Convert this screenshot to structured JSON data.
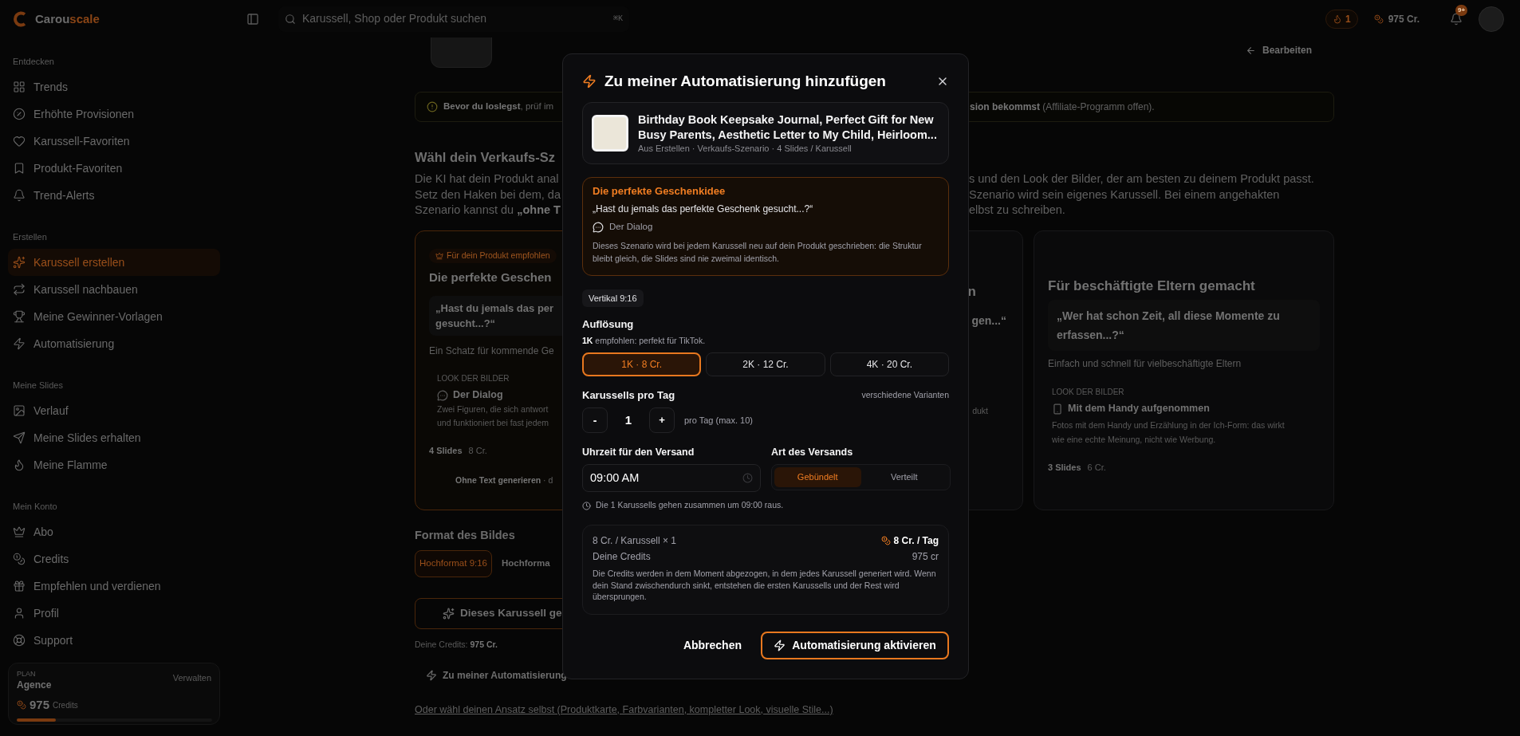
{
  "sidebar": {
    "brand": {
      "name": "Carou",
      "accent": "scale"
    },
    "sections": [
      {
        "title": "Entdecken",
        "items": [
          {
            "label": "Trends",
            "selected": false
          },
          {
            "label": "Erhöhte Provisionen",
            "selected": false
          },
          {
            "label": "Karussell-Favoriten",
            "selected": false
          },
          {
            "label": "Produkt-Favoriten",
            "selected": false
          },
          {
            "label": "Trend-Alerts",
            "selected": false
          }
        ]
      },
      {
        "title": "Erstellen",
        "items": [
          {
            "label": "Karussell erstellen",
            "selected": true
          },
          {
            "label": "Karussell nachbauen",
            "selected": false
          },
          {
            "label": "Meine Gewinner-Vorlagen",
            "selected": false
          },
          {
            "label": "Automatisierung",
            "selected": false
          }
        ]
      },
      {
        "title": "Meine Slides",
        "items": [
          {
            "label": "Verlauf",
            "selected": false
          },
          {
            "label": "Meine Slides erhalten",
            "selected": false
          },
          {
            "label": "Meine Flamme",
            "selected": false
          }
        ]
      },
      {
        "title": "Mein Konto",
        "items": [
          {
            "label": "Abo",
            "selected": false
          },
          {
            "label": "Credits",
            "selected": false
          },
          {
            "label": "Empfehlen und verdienen",
            "selected": false
          },
          {
            "label": "Profil",
            "selected": false
          },
          {
            "label": "Support",
            "selected": false
          }
        ]
      }
    ],
    "plan": {
      "label": "PLAN",
      "name": "Agence",
      "action": "Verwalten",
      "credits": "975",
      "unit": "Credits",
      "level": 0.2
    }
  },
  "topbar": {
    "search_placeholder": "Karussell, Shop oder Produkt suchen",
    "shortcut": "⌘K",
    "streak": "1",
    "credits": "975 Cr.",
    "notification_badge": "9+"
  },
  "page": {
    "back_link": "Bearbeiten",
    "notice_left": "**Bevor du loslegst**, prüf im",
    "notice_right": "**sion bekommst** (Affiliate-Programm offen).",
    "heading": "Wähl dein Verkaufs-Sz",
    "intro_left": [
      "Die KI hat dein Produkt anal",
      "Setz den Haken bei dem, da",
      "Szenario kannst du **„ohne T**"
    ],
    "intro_right": [
      "s und den Look der Bilder, der am besten zu deinem Produkt passt.",
      "Szenario wird sein eigenes Karussell. Bei einem angehakten",
      "elbst zu schreiben."
    ],
    "recommended_card": {
      "selected": true,
      "badge": "Für dein Produkt empfohlen",
      "title": "Die perfekte Geschen",
      "quote_lines": [
        "„Hast du jemals das per",
        "gesucht...?“"
      ],
      "subtitle": "Ein Schatz für kommende Ge",
      "look_label": "LOOK DER BILDER",
      "look_name": "Der Dialog",
      "look_lines": [
        "Zwei Figuren, die sich antwort",
        "und funktioniert bei fast jedem"
      ],
      "slides": "4 Slides",
      "cost": "8 Cr.",
      "action": "**Ohne Text generieren** · d"
    },
    "middle_card": {
      "title": "n",
      "quote": "gen...“",
      "note": "dukt"
    },
    "right_card": {
      "selected": false,
      "title": "Für beschäftigte Eltern gemacht",
      "quote": "„Wer hat schon Zeit, all diese Momente zu erfassen...?“",
      "subtitle": "Einfach und schnell für vielbeschäftigte Eltern",
      "look_label": "LOOK DER BILDER",
      "look_name": "Mit dem Handy aufgenommen",
      "look_text": "Fotos mit dem Handy und Erzählung in der Ich-Form: das wirkt wie eine echte Meinung, nicht wie Werbung.",
      "slides": "3 Slides",
      "cost": "6 Cr."
    },
    "format_title": "Format des Bildes",
    "format_options": [
      {
        "label": "Hochformat 9:16",
        "selected": true
      },
      {
        "label": "Hochforma",
        "selected": false
      }
    ],
    "generate_button": "Dieses Karussell ge",
    "credits_line": "Deine Credits: **975 Cr.**",
    "automation_link": "Zu meiner Automatisierung",
    "bottom_link": "Oder wähl deinen Ansatz selbst (Produktkarte, Farbvarianten, kompletter Look, visuelle Stile...)"
  },
  "modal": {
    "title": "Zu meiner Automatisierung hinzufügen",
    "product": {
      "title": "Birthday Book Keepsake Journal, Perfect Gift for New Busy Parents, Aesthetic Letter to My Child, Heirloom...",
      "meta": "Aus Erstellen · Verkaufs-Szenario · 4 Slides / Karussell"
    },
    "scenario": {
      "title": "Die perfekte Geschenkidee",
      "quote": "„Hast du jemals das perfekte Geschenk gesucht...?“",
      "look": "Der Dialog",
      "description": "Dieses Szenario wird bei jedem Karussell neu auf dein Produkt geschrieben: die Struktur bleibt gleich, die Slides sind nie zweimal identisch."
    },
    "format_chip": "Vertikal 9:16",
    "resolution_label": "Auflösung",
    "resolution_hint": "**1K** empfohlen: perfekt für TikTok.",
    "resolution_options": [
      {
        "label": "1K · 8 Cr.",
        "selected": true
      },
      {
        "label": "2K · 12 Cr.",
        "selected": false
      },
      {
        "label": "4K · 20 Cr.",
        "selected": false
      }
    ],
    "per_day": {
      "label": "Karussells pro Tag",
      "note": "verschiedene Varianten",
      "decrement": "-",
      "value": "1",
      "increment": "+",
      "suffix": "pro Tag (max. 10)"
    },
    "time_label": "Uhrzeit für den Versand",
    "time_value": "09:00 AM",
    "delivery_label": "Art des Versands",
    "delivery_options": [
      {
        "label": "Gebündelt",
        "selected": true
      },
      {
        "label": "Verteilt",
        "selected": false
      }
    ],
    "schedule_note": "Die 1 Karussells gehen zusammen um 09:00 raus.",
    "summary": {
      "rate": "8 Cr. / Karussell × 1",
      "total": "8 Cr. / Tag",
      "credits_label": "Deine Credits",
      "credits_value": "975 cr",
      "note": "Die Credits werden in dem Moment abgezogen, in dem jedes Karussell generiert wird. Wenn dein Stand zwischendurch sinkt, entstehen die ersten Karussells und der Rest wird übersprungen."
    },
    "cancel": "Abbrechen",
    "confirm": "Automatisierung aktivieren"
  }
}
